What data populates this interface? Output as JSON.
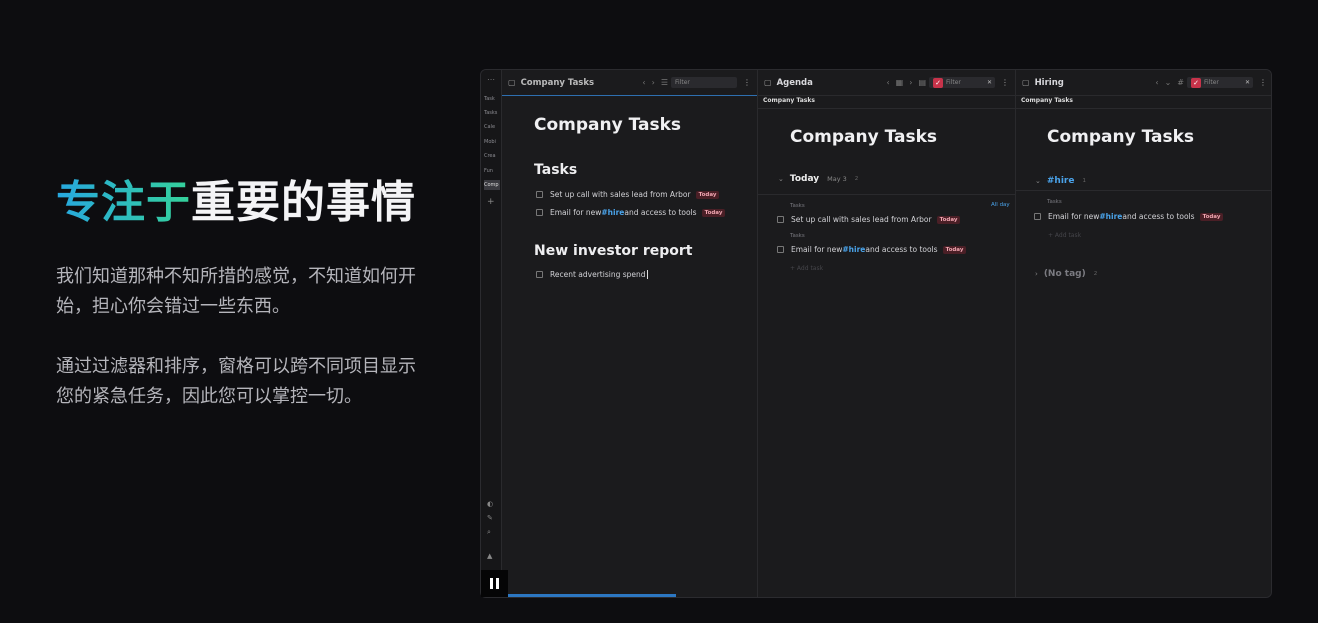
{
  "hero": {
    "title_highlight": "专注于",
    "title_rest": "重要的事情",
    "paragraph1": "我们知道那种不知所措的感觉，不知道如何开始，担心你会错过一些东西。",
    "paragraph2": "通过过滤器和排序，窗格可以跨不同项目显示您的紧急任务，因此您可以掌控一切。"
  },
  "sidebar": {
    "items": [
      "Task",
      "Tasks",
      "Cale",
      "Mobi",
      "Crea",
      "Fun",
      "Comp"
    ],
    "active_index": 6,
    "plus": "+"
  },
  "pane1": {
    "title": "Company Tasks",
    "filter_placeholder": "Filter",
    "heading": "Company Tasks",
    "sections": [
      {
        "title": "Tasks",
        "tasks": [
          {
            "text": "Set up call with sales lead from Arbor",
            "badge": "Today"
          },
          {
            "pre": "Email for new ",
            "tag": "#hire",
            "post": " and access to tools",
            "badge": "Today"
          }
        ]
      },
      {
        "title": "New investor report",
        "tasks": [
          {
            "text": "Recent advertising spend"
          }
        ]
      }
    ]
  },
  "pane2": {
    "title": "Agenda",
    "subtitle": "Company Tasks",
    "filter_placeholder": "Filter",
    "heading": "Company Tasks",
    "group": {
      "label": "Today",
      "date": "May 3",
      "count": "2"
    },
    "all_day": "All day",
    "tasks": [
      {
        "project": "Tasks",
        "text": "Set up call with sales lead from Arbor",
        "badge": "Today"
      },
      {
        "project": "Tasks",
        "pre": "Email for new ",
        "tag": "#hire",
        "post": " and access to tools",
        "badge": "Today"
      }
    ],
    "add_task": "+ Add task"
  },
  "pane3": {
    "title": "Hiring",
    "subtitle": "Company Tasks",
    "filter_placeholder": "Filter",
    "heading": "Company Tasks",
    "group": {
      "label": "#hire",
      "count": "1"
    },
    "tasks": [
      {
        "project": "Tasks",
        "pre": "Email for new ",
        "tag": "#hire",
        "post": " and access to tools",
        "badge": "Today"
      }
    ],
    "add_task": "+ Add task",
    "group2": {
      "label": "(No tag)",
      "count": "2"
    }
  },
  "colors": {
    "accent_blue": "#4aa3ea",
    "badge_bg": "#4a1f26",
    "badge_text": "#f0a5b0",
    "check_red": "#c7334a",
    "gradient_start": "#27a7e0",
    "gradient_end": "#35d29a"
  },
  "video": {
    "progress": 0.33
  }
}
